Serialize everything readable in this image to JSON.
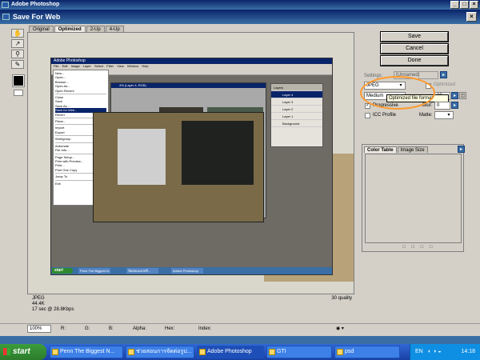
{
  "photoshop": {
    "title": "Adobe Photoshop"
  },
  "dialog": {
    "title": "Save For Web"
  },
  "tabs": [
    "Original",
    "Optimized",
    "2-Up",
    "4-Up"
  ],
  "buttons": {
    "save": "Save",
    "cancel": "Cancel",
    "done": "Done"
  },
  "settings": {
    "label": "Settings:",
    "value": "[Unnamed]",
    "format": "JPEG",
    "optimized_label": "Optimized",
    "quality_preset": "Medium",
    "quality_value": "30",
    "tooltip": "Optimized file format",
    "progressive_label": "Progressive",
    "progressive_checked": true,
    "icc_label": "ICC Profile",
    "blur_label": "Blur:",
    "blur_value": "0",
    "matte_label": "Matte:"
  },
  "color_panel": {
    "tabs": [
      "Color Table",
      "Image Size"
    ]
  },
  "status": {
    "format": "JPEG",
    "size": "44.4K",
    "time": "17 sec @ 28.8Kbps",
    "quality": "30 quality"
  },
  "bottom_bar": {
    "zoom": "100%",
    "readouts": [
      "R:",
      "G:",
      "B:",
      "Alpha:",
      "Hex:",
      "Index:"
    ]
  },
  "inner_screenshot": {
    "title": "Adobe Photoshop",
    "menubar": [
      "File",
      "Edit",
      "Image",
      "Layer",
      "Select",
      "Filter",
      "View",
      "Window",
      "Help"
    ],
    "file_menu": [
      "New...",
      "Open...",
      "Browse...",
      "Open As...",
      "Open Recent",
      "Close",
      "Save",
      "Save As...",
      "Save for Web...",
      "Revert",
      "Place...",
      "Import",
      "Export",
      "Workgroup",
      "Automate",
      "File Info...",
      "Page Setup...",
      "Print with Preview...",
      "Print...",
      "Print One Copy",
      "Jump To",
      "Exit"
    ],
    "doc_title": "4% (Layer 4, RGB)",
    "layers": [
      "Layer 4",
      "Layer 3",
      "Layer 2",
      "Layer 1",
      "Background"
    ],
    "taskbar_items": [
      "Penn The Biggest N...",
      "ข้อสอบแจกฟรี...",
      "Adobe Photoshop"
    ],
    "start": "start"
  },
  "taskbar": {
    "start": "start",
    "items": [
      "Penn The Biggest N...",
      "ช่วยสอนการจัดต่อรูป...",
      "Adobe Photoshop",
      "GTI",
      "psd"
    ],
    "lang": "EN",
    "time": "14:18"
  },
  "colors": {
    "accent_orange": "#ff9a2e",
    "title_blue": "#0a246a",
    "dialog_gray": "#d4d0c8"
  }
}
